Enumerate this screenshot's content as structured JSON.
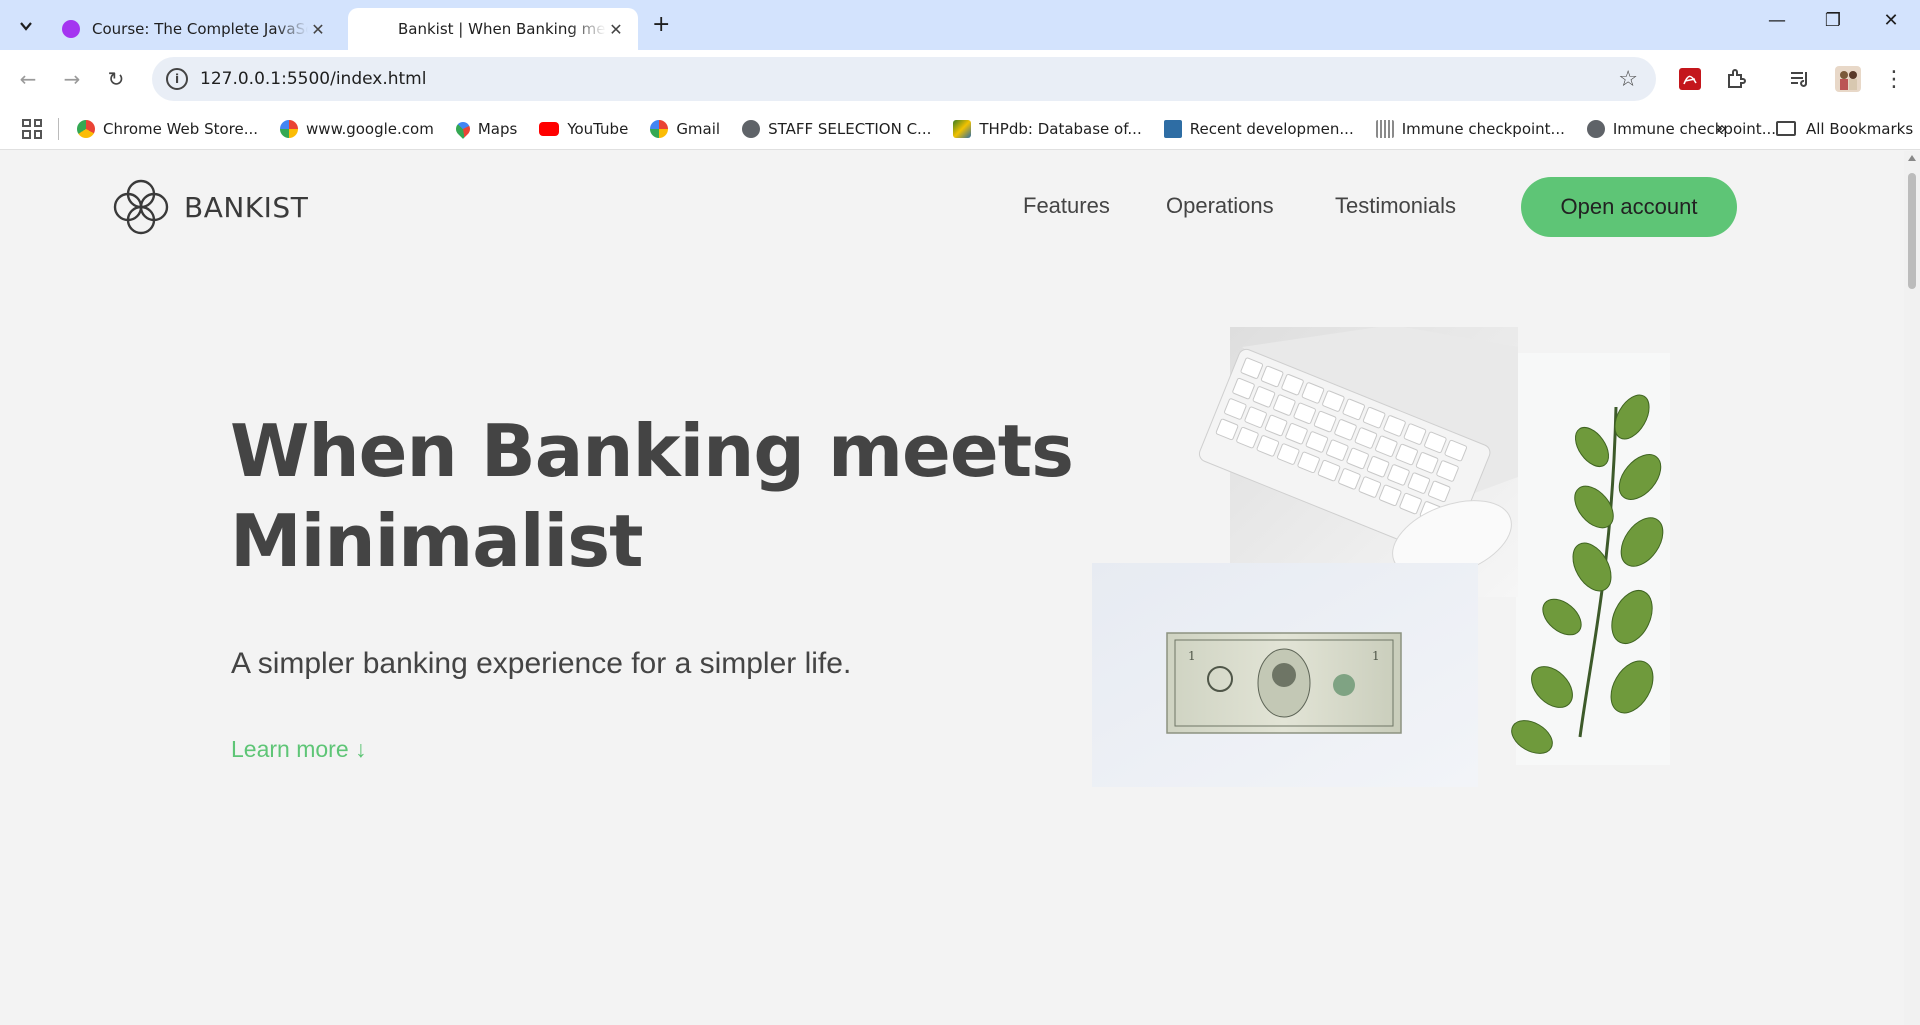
{
  "browser": {
    "tabs": [
      {
        "title": "Course: The Complete JavaScript",
        "active": false,
        "favicon_color": "#a435f0"
      },
      {
        "title": "Bankist | When Banking meets Minimalist",
        "active": true,
        "favicon_color": ""
      }
    ],
    "url": "127.0.0.1:5500/index.html",
    "bookmarks": [
      {
        "label": "Chrome Web Store...",
        "icon": "chrome-web-store-icon",
        "color": "#ea4335"
      },
      {
        "label": "www.google.com",
        "icon": "google-icon",
        "color": "#4285f4"
      },
      {
        "label": "Maps",
        "icon": "maps-icon",
        "color": "#34a853"
      },
      {
        "label": "YouTube",
        "icon": "youtube-icon",
        "color": "#ff0000"
      },
      {
        "label": "Gmail",
        "icon": "google-icon",
        "color": "#4285f4"
      },
      {
        "label": "STAFF SELECTION C...",
        "icon": "globe-icon",
        "color": "#5f6368"
      },
      {
        "label": "THPdb: Database of...",
        "icon": "thpdb-icon",
        "color": "#3b7d23"
      },
      {
        "label": "Recent developmen...",
        "icon": "journal-icon",
        "color": "#2e6da4"
      },
      {
        "label": "Immune checkpoint...",
        "icon": "ncbi-icon",
        "color": "#8a8a8a"
      },
      {
        "label": "Immune checkpoint...",
        "icon": "globe-icon",
        "color": "#5f6368"
      }
    ],
    "all_bookmarks_label": "All Bookmarks"
  },
  "page": {
    "brand": "BANKIST",
    "nav": [
      {
        "label": "Features"
      },
      {
        "label": "Operations"
      },
      {
        "label": "Testimonials"
      }
    ],
    "cta_label": "Open account",
    "hero": {
      "word1": "When",
      "highlight1": "Banking",
      "word2": "meets",
      "highlight2": "Minimalist",
      "subtitle": "A simpler banking experience for a simpler life.",
      "learn_more": "Learn more ↓"
    },
    "colors": {
      "primary": "#5ec576",
      "background": "#f3f3f3",
      "text": "#444444"
    }
  }
}
